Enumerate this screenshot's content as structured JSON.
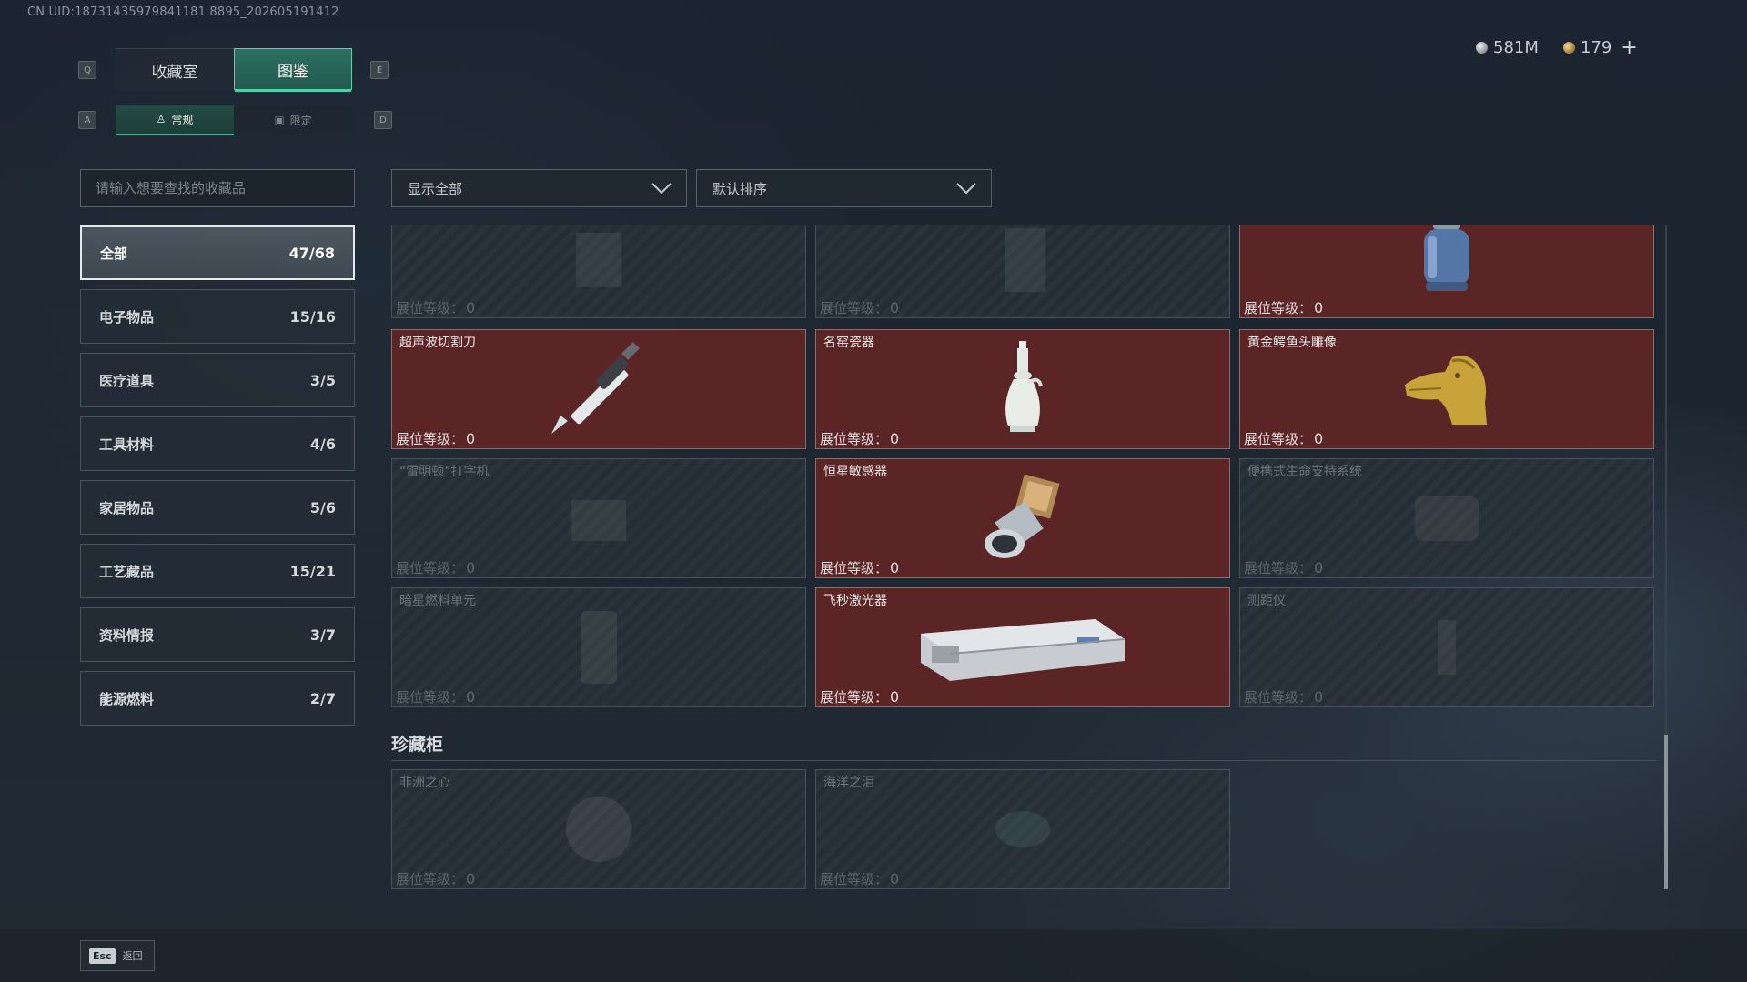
{
  "uid_text": "CN UID:18731435979841181 8895_202605191412",
  "currency": {
    "silver": "581M",
    "gold": "179",
    "plus": "+"
  },
  "keys": {
    "left_tab": "Q",
    "right_tab": "E",
    "left_sub": "A",
    "right_sub": "D"
  },
  "tabs": [
    {
      "label": "收藏室",
      "active": false
    },
    {
      "label": "图鉴",
      "active": true
    }
  ],
  "subtabs": [
    {
      "label": "常规",
      "icon": "person-icon",
      "active": true
    },
    {
      "label": "限定",
      "icon": "image-icon",
      "active": false
    }
  ],
  "search": {
    "placeholder": "请输入想要查找的收藏品"
  },
  "filters": {
    "show": "显示全部",
    "sort": "默认排序"
  },
  "categories": [
    {
      "label": "全部",
      "count": "47/68"
    },
    {
      "label": "电子物品",
      "count": "15/16"
    },
    {
      "label": "医疗道具",
      "count": "3/5"
    },
    {
      "label": "工具材料",
      "count": "4/6"
    },
    {
      "label": "家居物品",
      "count": "5/6"
    },
    {
      "label": "工艺藏品",
      "count": "15/21"
    },
    {
      "label": "资料情报",
      "count": "3/7"
    },
    {
      "label": "能源燃料",
      "count": "2/7"
    }
  ],
  "level_label": "展位等级：",
  "items": [
    {
      "name": "",
      "level": "0",
      "owned": false,
      "icon": "device-icon"
    },
    {
      "name": "",
      "level": "0",
      "owned": false,
      "icon": "radio-icon"
    },
    {
      "name": "",
      "level": "0",
      "owned": true,
      "icon": "gas-canister-icon"
    },
    {
      "name": "超声波切割刀",
      "level": "0",
      "owned": true,
      "icon": "ultrasonic-knife-icon"
    },
    {
      "name": "名窑瓷器",
      "level": "0",
      "owned": true,
      "icon": "porcelain-vase-icon"
    },
    {
      "name": "黄金鳄鱼头雕像",
      "level": "0",
      "owned": true,
      "icon": "golden-crocodile-icon"
    },
    {
      "name": "“雷明顿”打字机",
      "level": "0",
      "owned": false,
      "icon": "typewriter-icon"
    },
    {
      "name": "恒星敏感器",
      "level": "0",
      "owned": true,
      "icon": "star-sensor-icon"
    },
    {
      "name": "便携式生命支持系统",
      "level": "0",
      "owned": false,
      "icon": "life-support-icon"
    },
    {
      "name": "暗星燃料单元",
      "level": "0",
      "owned": false,
      "icon": "fuel-cell-icon"
    },
    {
      "name": "飞秒激光器",
      "level": "0",
      "owned": true,
      "icon": "femto-laser-icon"
    },
    {
      "name": "测距仪",
      "level": "0",
      "owned": false,
      "icon": "rangefinder-icon"
    }
  ],
  "cabinet": {
    "title": "珍藏柜",
    "items": [
      {
        "name": "非洲之心",
        "level": "0",
        "owned": false,
        "icon": "diamond-icon"
      },
      {
        "name": "海洋之泪",
        "level": "0",
        "owned": false,
        "icon": "gem-icon"
      }
    ]
  },
  "footer": {
    "esc_key": "Esc",
    "back": "返回"
  }
}
